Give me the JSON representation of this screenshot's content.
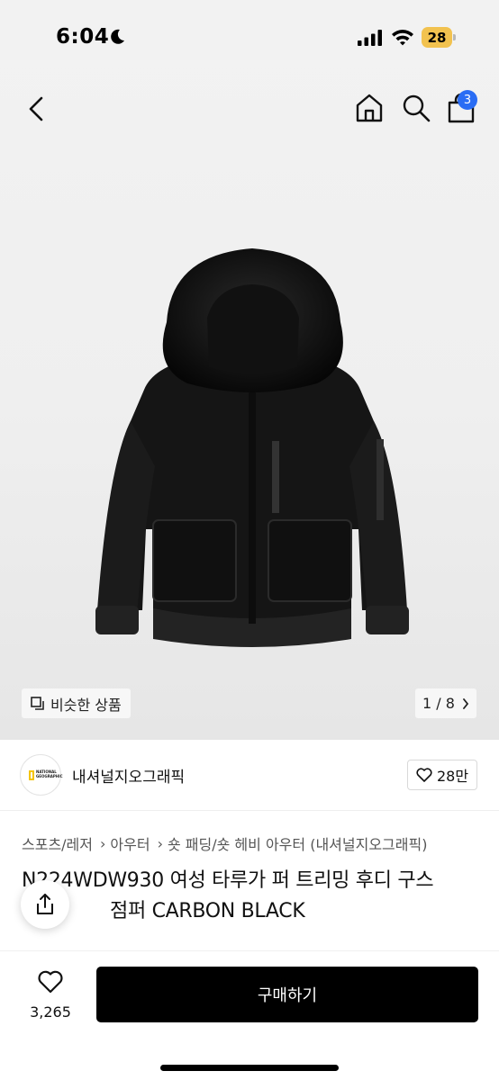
{
  "status_bar": {
    "time": "6:04",
    "battery_level": "28",
    "icons": [
      "moon-icon",
      "signal-icon",
      "wifi-icon",
      "battery-icon"
    ]
  },
  "nav": {
    "icons": [
      "back-icon",
      "home-icon",
      "search-icon",
      "cart-icon"
    ],
    "cart_count": "3"
  },
  "gallery": {
    "similar_label": "비슷한 상품",
    "page_current": "1",
    "page_total": "8",
    "page_indicator": "1 / 8"
  },
  "brand": {
    "name": "내셔널지오그래픽",
    "logo_text": "NATIONAL GEOGRAPHIC",
    "likes": "28만"
  },
  "breadcrumb": [
    "스포츠/레저",
    "아우터",
    "숏 패딩/숏 헤비 아우터 (내셔널지오그래픽)"
  ],
  "product": {
    "title_line1": "N224WDW930 여성 타루가 퍼 트리밍 후디 구스",
    "title_line2": "점퍼 CARBON BLACK"
  },
  "bottom_bar": {
    "like_count": "3,265",
    "buy_label": "구매하기"
  },
  "colors": {
    "accent_badge": "#2a6df4",
    "buy_button": "#000000",
    "battery": "#f2c24f"
  }
}
